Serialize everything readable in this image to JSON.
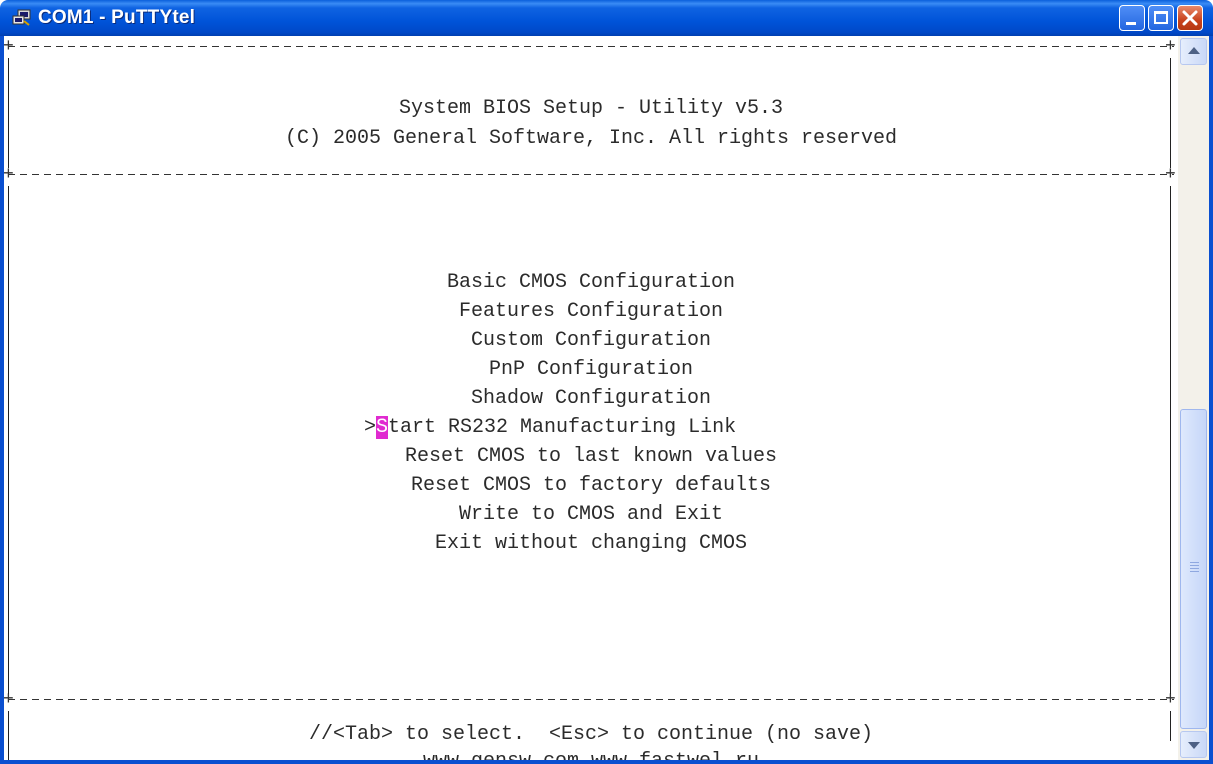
{
  "window": {
    "title": "COM1 - PuTTYtel",
    "icon": "putty-terminal-icon",
    "colors": {
      "titlebar": "#0053d8",
      "close": "#c8421c",
      "cursor": "#e02ad0"
    }
  },
  "terminal": {
    "header_line1": "System BIOS Setup - Utility v5.3",
    "header_line2": "(C) 2005 General Software, Inc. All rights reserved",
    "menu": {
      "items": [
        {
          "label": "Basic CMOS Configuration"
        },
        {
          "label": "Features Configuration"
        },
        {
          "label": "Custom Configuration"
        },
        {
          "label": "PnP Configuration"
        },
        {
          "label": "Shadow Configuration"
        },
        {
          "label": "Start RS232 Manufacturing Link",
          "selected": true,
          "marker": ">",
          "first_char": "S",
          "rest": "tart RS232 Manufacturing Link"
        },
        {
          "label": "Reset CMOS to last known values"
        },
        {
          "label": "Reset CMOS to factory defaults"
        },
        {
          "label": "Write to CMOS and Exit"
        },
        {
          "label": "Exit without changing CMOS"
        }
      ]
    },
    "footer_line1": "//<Tab> to select.  <Esc> to continue (no save)",
    "footer_line2": "www.gensw.com www.fastwel.ru"
  },
  "scrollbar": {
    "position": 0.56
  }
}
